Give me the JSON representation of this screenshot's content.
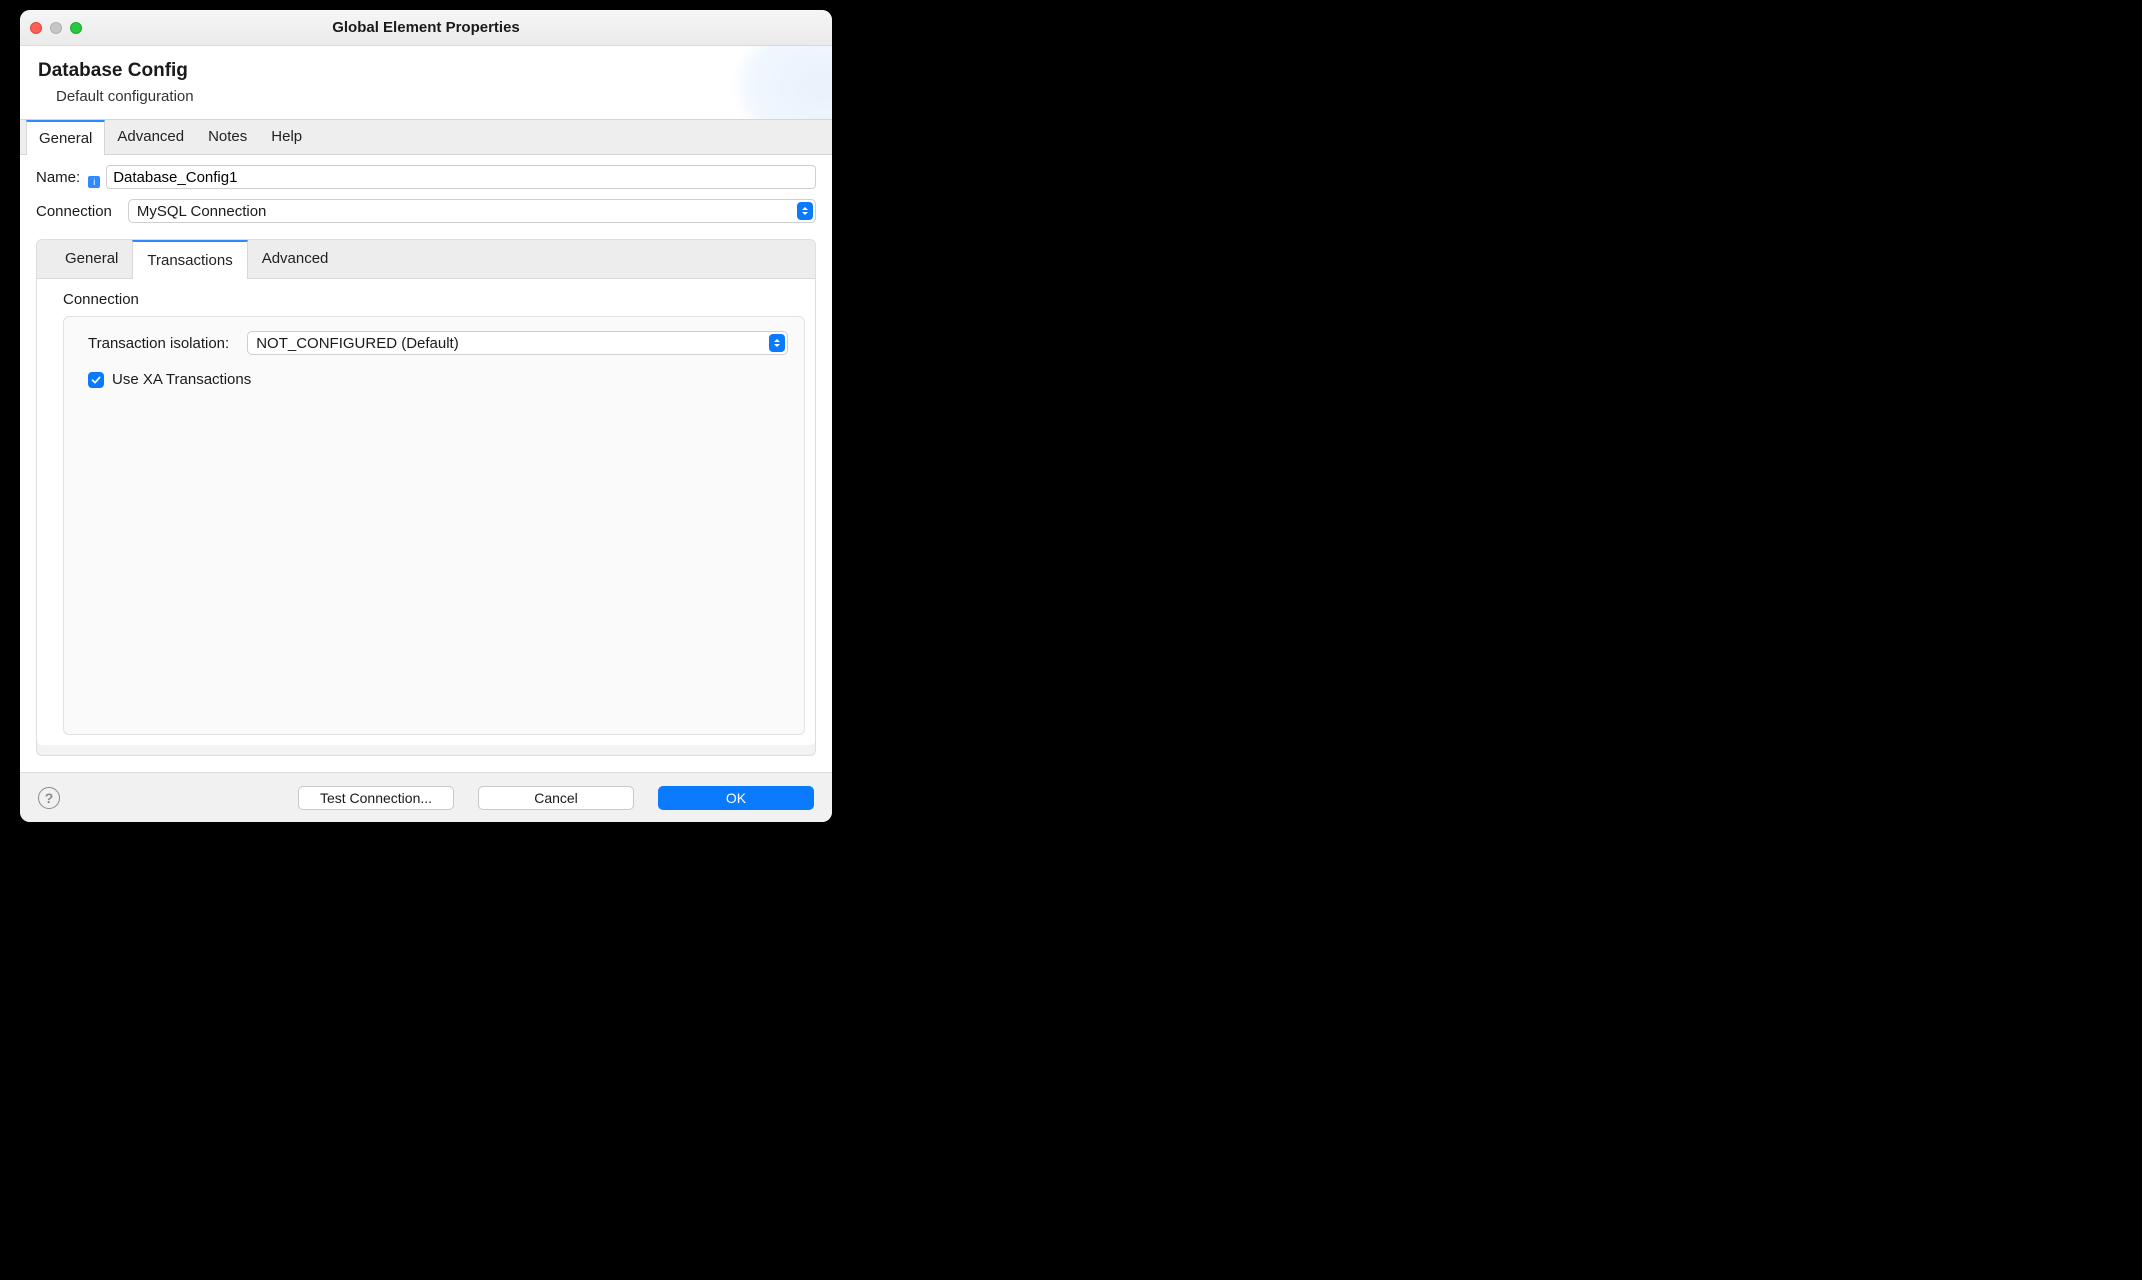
{
  "window": {
    "title": "Global Element Properties"
  },
  "header": {
    "title": "Database Config",
    "subtitle": "Default configuration"
  },
  "tabs": {
    "items": [
      "General",
      "Advanced",
      "Notes",
      "Help"
    ],
    "active": "General"
  },
  "form": {
    "name_label": "Name:",
    "name_value": "Database_Config1",
    "connection_label": "Connection",
    "connection_value": "MySQL Connection"
  },
  "subtabs": {
    "items": [
      "General",
      "Transactions",
      "Advanced"
    ],
    "active": "Transactions"
  },
  "transactions": {
    "group_label": "Connection",
    "isolation_label": "Transaction isolation:",
    "isolation_value": "NOT_CONFIGURED (Default)",
    "xa_label": "Use XA Transactions",
    "xa_checked": true
  },
  "footer": {
    "test_label": "Test Connection...",
    "cancel_label": "Cancel",
    "ok_label": "OK"
  },
  "icons": {
    "info": "i",
    "help": "?"
  }
}
